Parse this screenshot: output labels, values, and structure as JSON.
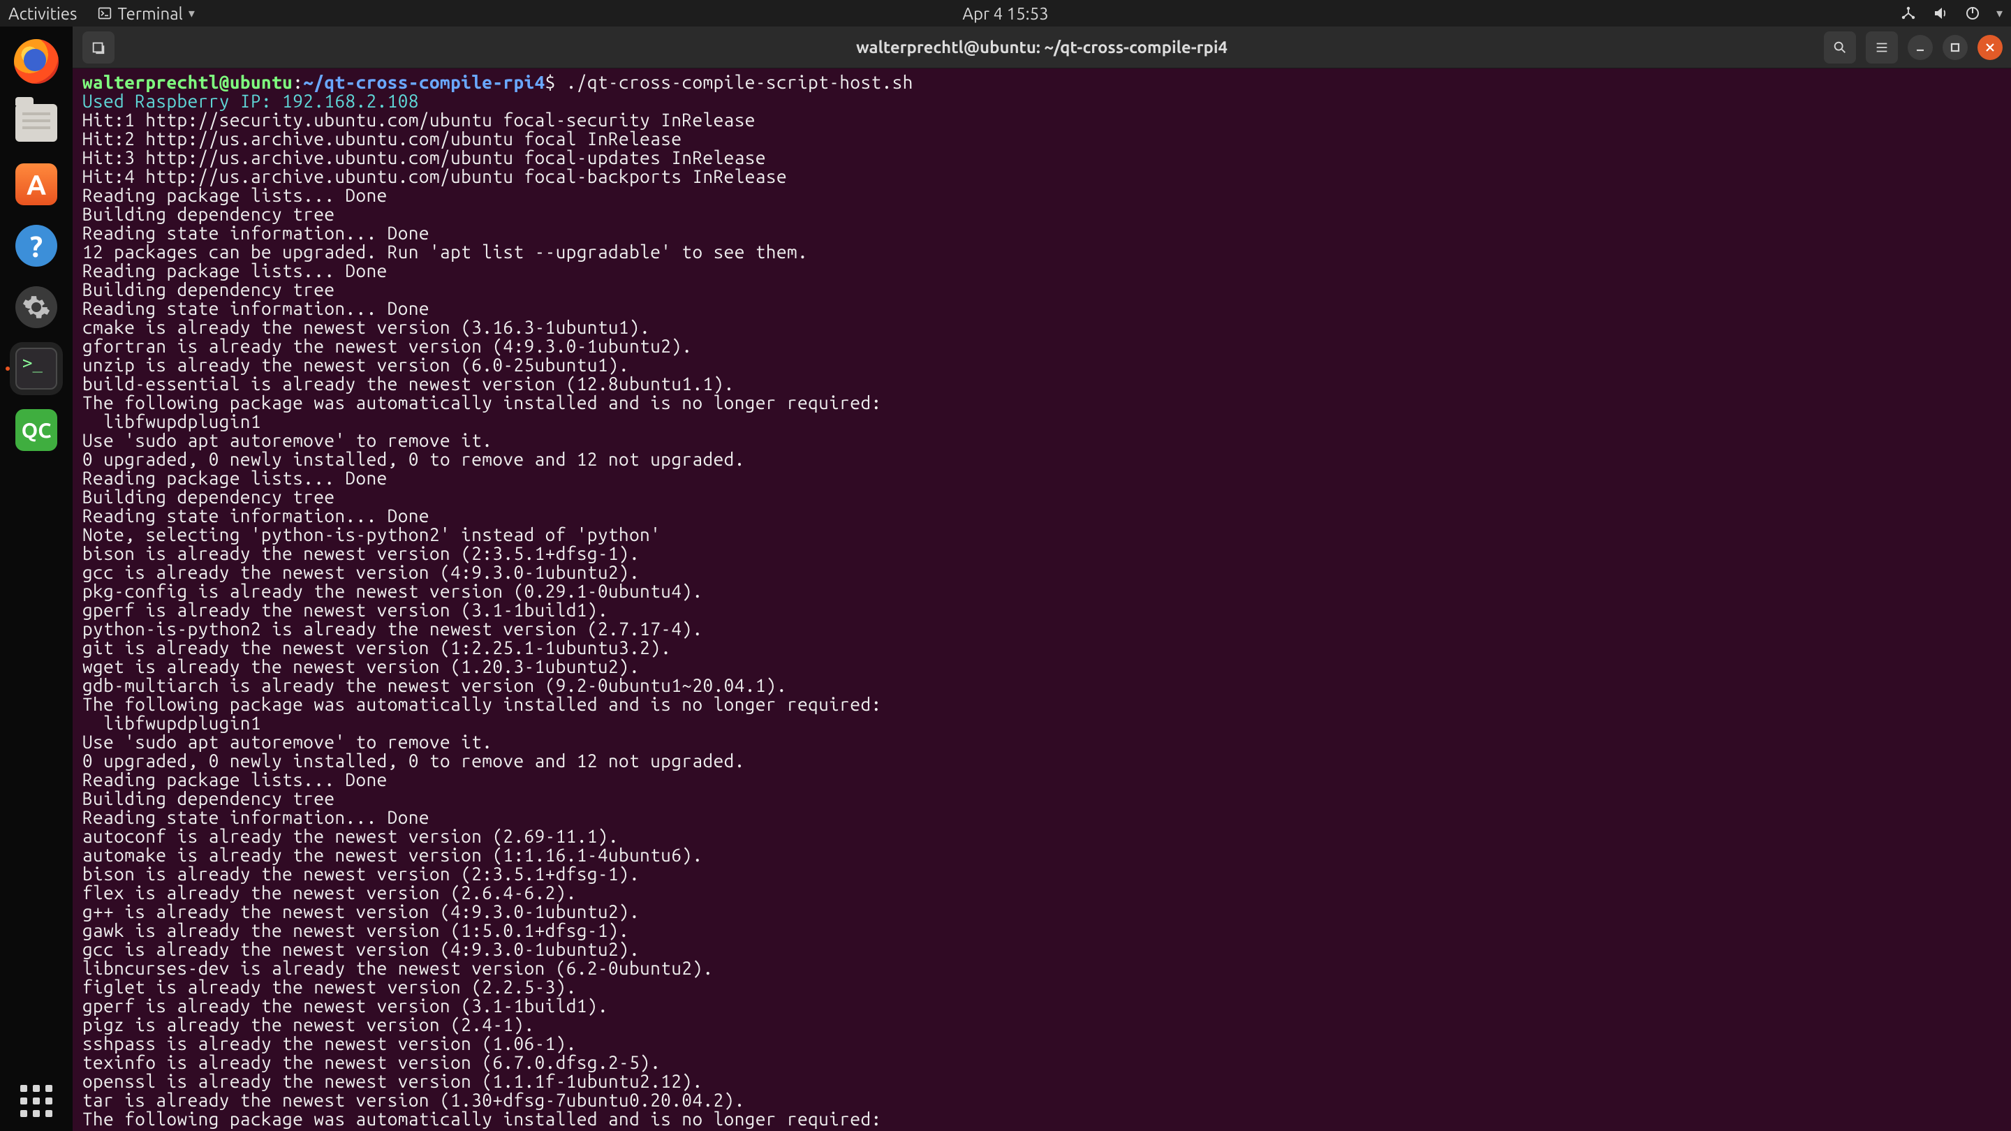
{
  "top_panel": {
    "activities": "Activities",
    "app_menu": "Terminal",
    "clock": "Apr 4  15:53"
  },
  "dock": {
    "qc_label": "QC"
  },
  "window": {
    "title": "walterprechtl@ubuntu: ~/qt-cross-compile-rpi4"
  },
  "prompt": {
    "user_host": "walterprechtl@ubuntu",
    "colon": ":",
    "path": "~/qt-cross-compile-rpi4",
    "dollar": "$ ",
    "command": "./qt-cross-compile-script-host.sh"
  },
  "line_raspberry": "Used Raspberry IP: 192.168.2.108",
  "output": [
    "Hit:1 http://security.ubuntu.com/ubuntu focal-security InRelease",
    "Hit:2 http://us.archive.ubuntu.com/ubuntu focal InRelease",
    "Hit:3 http://us.archive.ubuntu.com/ubuntu focal-updates InRelease",
    "Hit:4 http://us.archive.ubuntu.com/ubuntu focal-backports InRelease",
    "Reading package lists... Done",
    "Building dependency tree",
    "Reading state information... Done",
    "12 packages can be upgraded. Run 'apt list --upgradable' to see them.",
    "Reading package lists... Done",
    "Building dependency tree",
    "Reading state information... Done",
    "cmake is already the newest version (3.16.3-1ubuntu1).",
    "gfortran is already the newest version (4:9.3.0-1ubuntu2).",
    "unzip is already the newest version (6.0-25ubuntu1).",
    "build-essential is already the newest version (12.8ubuntu1.1).",
    "The following package was automatically installed and is no longer required:",
    "  libfwupdplugin1",
    "Use 'sudo apt autoremove' to remove it.",
    "0 upgraded, 0 newly installed, 0 to remove and 12 not upgraded.",
    "Reading package lists... Done",
    "Building dependency tree",
    "Reading state information... Done",
    "Note, selecting 'python-is-python2' instead of 'python'",
    "bison is already the newest version (2:3.5.1+dfsg-1).",
    "gcc is already the newest version (4:9.3.0-1ubuntu2).",
    "pkg-config is already the newest version (0.29.1-0ubuntu4).",
    "gperf is already the newest version (3.1-1build1).",
    "python-is-python2 is already the newest version (2.7.17-4).",
    "git is already the newest version (1:2.25.1-1ubuntu3.2).",
    "wget is already the newest version (1.20.3-1ubuntu2).",
    "gdb-multiarch is already the newest version (9.2-0ubuntu1~20.04.1).",
    "The following package was automatically installed and is no longer required:",
    "  libfwupdplugin1",
    "Use 'sudo apt autoremove' to remove it.",
    "0 upgraded, 0 newly installed, 0 to remove and 12 not upgraded.",
    "Reading package lists... Done",
    "Building dependency tree",
    "Reading state information... Done",
    "autoconf is already the newest version (2.69-11.1).",
    "automake is already the newest version (1:1.16.1-4ubuntu6).",
    "bison is already the newest version (2:3.5.1+dfsg-1).",
    "flex is already the newest version (2.6.4-6.2).",
    "g++ is already the newest version (4:9.3.0-1ubuntu2).",
    "gawk is already the newest version (1:5.0.1+dfsg-1).",
    "gcc is already the newest version (4:9.3.0-1ubuntu2).",
    "libncurses-dev is already the newest version (6.2-0ubuntu2).",
    "figlet is already the newest version (2.2.5-3).",
    "gperf is already the newest version (3.1-1build1).",
    "pigz is already the newest version (2.4-1).",
    "sshpass is already the newest version (1.06-1).",
    "texinfo is already the newest version (6.7.0.dfsg.2-5).",
    "openssl is already the newest version (1.1.1f-1ubuntu2.12).",
    "tar is already the newest version (1.30+dfsg-7ubuntu0.20.04.2).",
    "The following package was automatically installed and is no longer required:"
  ]
}
